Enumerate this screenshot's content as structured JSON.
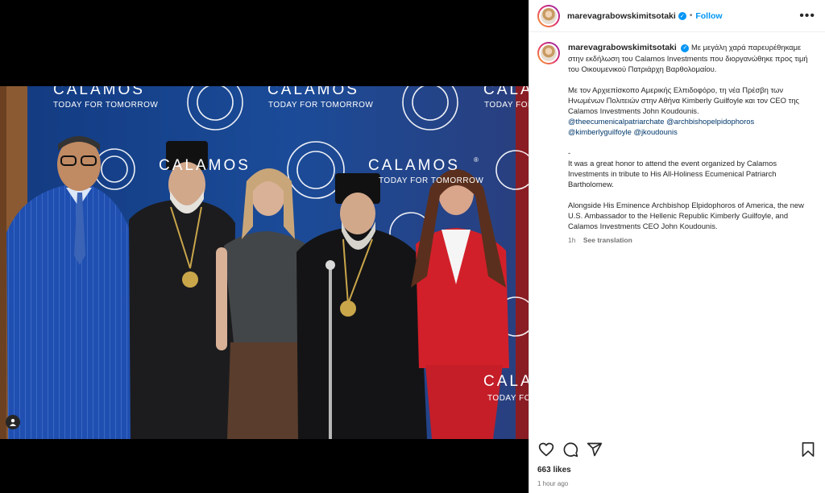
{
  "post": {
    "username": "marevagrabowskimitsotaki",
    "separator": "•",
    "follow_label": "Follow",
    "more_label": "•••",
    "verified_mark": "✓"
  },
  "caption": {
    "username": "marevagrabowskimitsotaki",
    "greek_1": "Με μεγάλη χαρά παρευρέθηκαμε στην εκδήλωση του Calamos Investments που διοργανώθηκε προς τιμή του Οικουμενικού Πατριάρχη Βαρθολομαίου.",
    "greek_2": "Με τον Αρχιεπίσκοπο Αμερικής Ελπιδοφόρο, τη νέα Πρέσβη των Ηνωμένων Πολιτειών στην Αθήνα Kimberly Guilfoyle και τον CEO της Calamos Investments John Koudounis.",
    "mentions": [
      "@theecumenicalpatriarchate",
      "@archbishopelpidophoros",
      "@kimberlyguilfoyle",
      "@jkoudounis"
    ],
    "dash": "-",
    "english_1": "It was a great honor to attend the event organized by Calamos Investments in tribute to His All-Holiness Ecumenical Patriarch Bartholomew.",
    "english_2": "Alongside His Eminence Archbishop Elpidophoros of America, the new U.S. Ambassador to the Hellenic Republic Kimberly Guilfoyle, and Calamos Investments CEO John Koudounis.",
    "age": "1h",
    "translate_label": "See translation"
  },
  "backdrop": {
    "brand": "CALAMOS",
    "registered": "®",
    "tagline": "TODAY FOR TOMORROW"
  },
  "engagement": {
    "likes": "663 likes",
    "timestamp": "1 hour ago"
  },
  "icons": [
    "heart-icon",
    "comment-icon",
    "share-icon",
    "bookmark-icon",
    "more-icon",
    "user-tag-icon",
    "verified-icon"
  ],
  "colors": {
    "accent": "#0095f6",
    "mention": "#00376b",
    "backdrop": "#17438e"
  }
}
